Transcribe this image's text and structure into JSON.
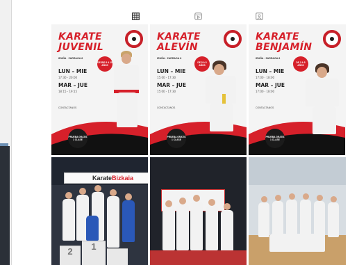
{
  "tabs": [
    {
      "icon": "grid-icon",
      "active": true
    },
    {
      "icon": "reels-icon",
      "active": false
    },
    {
      "icon": "tagged-icon",
      "active": false
    }
  ],
  "posts": [
    {
      "type": "poster",
      "title_line1": "KARATE",
      "title_line2": "JUVENIL",
      "subline": "IRUÑA · ZARRAGA 8",
      "days1": "LUN – MIE",
      "time1": "17:30 - 20:00",
      "days2": "MAR – JUE",
      "time2": "18:15 - 19:15",
      "contact": "CONTACTANOS",
      "badge": "DESDE 6 A 15 AÑOS",
      "clip": "PRUEBA GRATIS 1 CLASE"
    },
    {
      "type": "poster",
      "title_line1": "KARATE",
      "title_line2": "ALEVÍN",
      "subline": "IRUÑA · ZARRAGA 8",
      "days1": "LUN – MIE",
      "time1": "15:00 - 17:30",
      "days2": "MAR – JUE",
      "time2": "15:00 - 17:30",
      "contact": "CONTACTANOS",
      "badge": "DE 5 A 8 AÑOS",
      "clip": "PRUEBA GRATIS 1 CLASE"
    },
    {
      "type": "poster",
      "title_line1": "KARATE",
      "title_line2": "BENJAMÍN",
      "subline": "IRUÑA · ZARRAGA 8",
      "days1": "LUN – MIE",
      "time1": "17:00 - 18:00",
      "days2": "MAR – JUE",
      "time2": "17:00 - 18:00",
      "contact": "CONTACTANOS",
      "badge": "DE 3 A 5 AÑOS",
      "clip": "PRUEBA GRATIS 1 CLASE"
    },
    {
      "type": "photo",
      "banner_prefix": "Karate",
      "banner_accent": "Bizkaia",
      "podium": [
        "2",
        "1"
      ]
    },
    {
      "type": "photo"
    },
    {
      "type": "photo"
    }
  ],
  "colors": {
    "brand_red": "#d6202a",
    "tab_active": "#262626",
    "tab_inactive": "#9a9a9a"
  }
}
